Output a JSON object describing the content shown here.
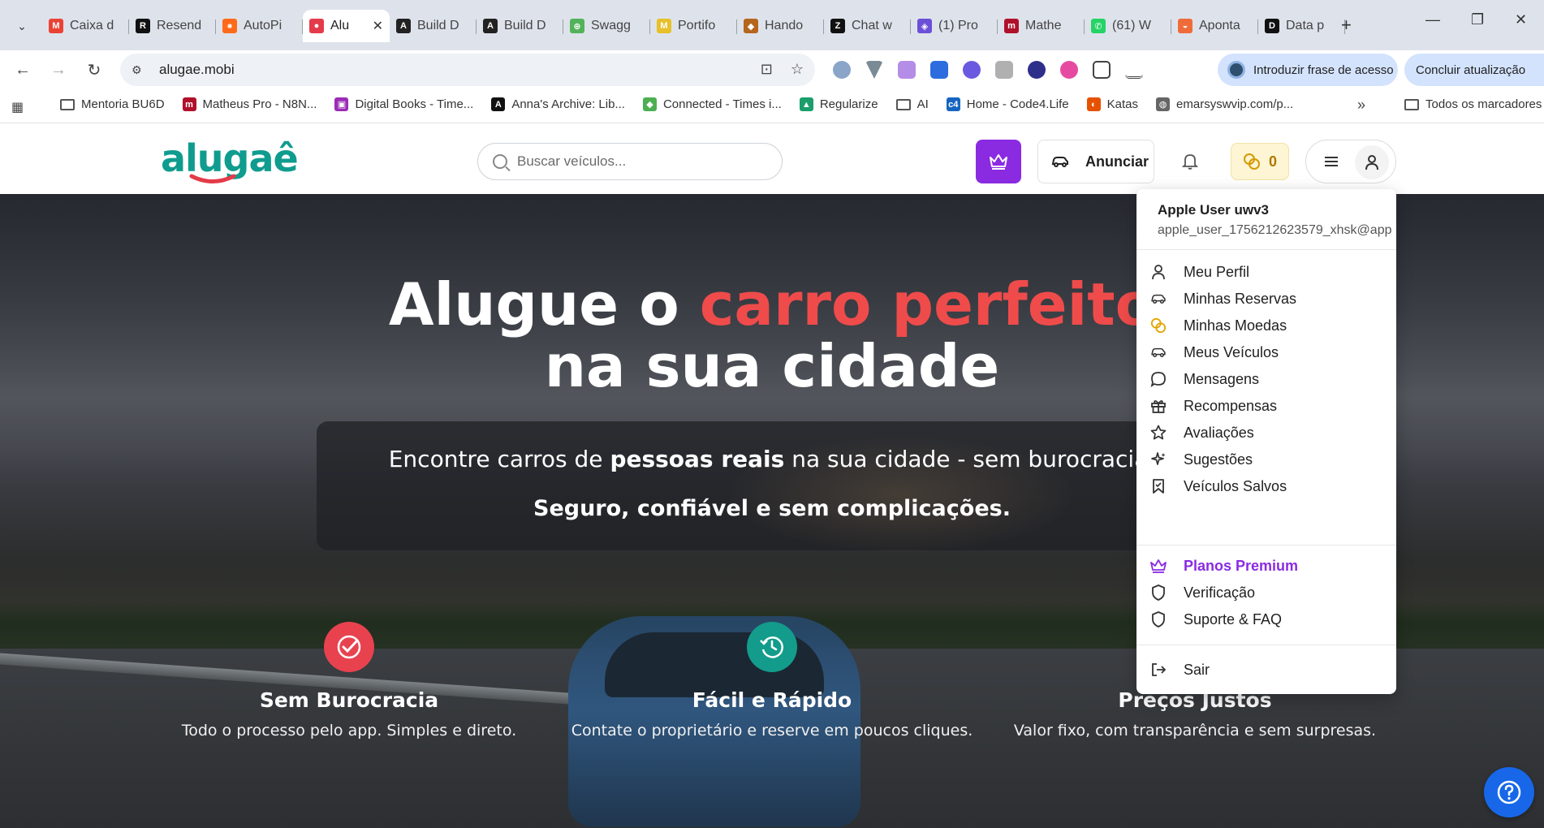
{
  "browser": {
    "tabs": [
      {
        "label": "Caixa d",
        "fav_color": "#ea4335",
        "fav_char": "M"
      },
      {
        "label": "Resend",
        "fav_color": "#111111",
        "fav_char": "R"
      },
      {
        "label": "AutoPi",
        "fav_color": "#ff6a1a",
        "fav_char": "⁕"
      },
      {
        "label": "Alu",
        "fav_color": "#e33b49",
        "fav_char": "●",
        "active": true
      },
      {
        "label": "Build D",
        "fav_color": "#222222",
        "fav_char": "A"
      },
      {
        "label": "Build D",
        "fav_color": "#222222",
        "fav_char": "A"
      },
      {
        "label": "Swagg",
        "fav_color": "#52b35b",
        "fav_char": "⊕"
      },
      {
        "label": "Portifo",
        "fav_color": "#e7c02a",
        "fav_char": "M"
      },
      {
        "label": "Hando",
        "fav_color": "#b5651d",
        "fav_char": "◆"
      },
      {
        "label": "Chat w",
        "fav_color": "#111111",
        "fav_char": "Z"
      },
      {
        "label": "(1) Pro",
        "fav_color": "#6b4fd8",
        "fav_char": "◈"
      },
      {
        "label": "Mathe",
        "fav_color": "#b0102a",
        "fav_char": "m"
      },
      {
        "label": "(61) W",
        "fav_color": "#25d366",
        "fav_char": "✆"
      },
      {
        "label": "Aponta",
        "fav_color": "#ef6c3a",
        "fav_char": "◒"
      },
      {
        "label": "Data p",
        "fav_color": "#111111",
        "fav_char": "D"
      }
    ],
    "url": "alugae.mobi",
    "passkey_label": "Introduzir frase de acesso",
    "update_label": "Concluir atualização",
    "bookmarks": [
      {
        "label": "Mentoria BU6D",
        "type": "folder"
      },
      {
        "label": "Matheus Pro - N8N...",
        "color": "#b0102a",
        "char": "m"
      },
      {
        "label": "Digital Books - Time...",
        "color": "#9b2bb5",
        "char": "▣"
      },
      {
        "label": "Anna's Archive: Lib...",
        "color": "#111111",
        "char": "A"
      },
      {
        "label": "Connected - Times i...",
        "color": "#4caf50",
        "char": "◆"
      },
      {
        "label": "Regularize",
        "color": "#1b9e6b",
        "char": "▲"
      },
      {
        "label": "AI",
        "type": "folder"
      },
      {
        "label": "Home - Code4.Life",
        "color": "#1565c0",
        "char": "c4"
      },
      {
        "label": "Katas",
        "color": "#e65100",
        "char": "◐"
      },
      {
        "label": "emarsyswvip.com/p...",
        "color": "#666666",
        "char": "◍"
      }
    ],
    "all_bookmarks": "Todos os marcadores"
  },
  "header": {
    "logo_main": "alugaê",
    "search_placeholder": "Buscar veículos...",
    "anunciar_label": "Anunciar",
    "coins_count": "0"
  },
  "hero": {
    "headline_prefix": "Alugue o ",
    "headline_highlight": "carro perfeito",
    "headline_line2": "na sua cidade",
    "sub1_a": "Encontre carros de ",
    "sub1_b": "pessoas reais",
    "sub1_c": " na sua cidade - sem burocracia.",
    "sub2": "Seguro, confiável e sem complicações.",
    "features": [
      {
        "title": "Sem Burocracia",
        "desc": "Todo o processo pelo app. Simples e direto.",
        "icon_color": "#e8424f"
      },
      {
        "title": "Fácil e Rápido",
        "desc": "Contate o proprietário e reserve em poucos cliques.",
        "icon_color": "#139c8b"
      },
      {
        "title": "Preços Justos",
        "desc": "Valor fixo, com transparência e sem surpresas."
      }
    ]
  },
  "menu": {
    "user_name": "Apple User uwv3",
    "user_email": "apple_user_1756212623579_xhsk@app",
    "items": [
      {
        "label": "Meu Perfil",
        "icon": "user-icon"
      },
      {
        "label": "Minhas Reservas",
        "icon": "car-icon"
      },
      {
        "label": "Minhas Moedas",
        "icon": "coins-icon"
      },
      {
        "label": "Meus Veículos",
        "icon": "car-icon"
      },
      {
        "label": "Mensagens",
        "icon": "message-icon"
      },
      {
        "label": "Recompensas",
        "icon": "gift-icon"
      },
      {
        "label": "Avaliações",
        "icon": "star-icon"
      },
      {
        "label": "Sugestões",
        "icon": "sparkles-icon"
      },
      {
        "label": "Veículos Salvos",
        "icon": "bookmark-icon"
      }
    ],
    "premium_label": "Planos Premium",
    "verification_label": "Verificação",
    "support_label": "Suporte & FAQ",
    "logout_label": "Sair"
  },
  "colors": {
    "brand_teal": "#0f9c8f",
    "brand_red": "#e33b49",
    "premium_purple": "#8a2be2",
    "help_blue": "#1767e8"
  }
}
